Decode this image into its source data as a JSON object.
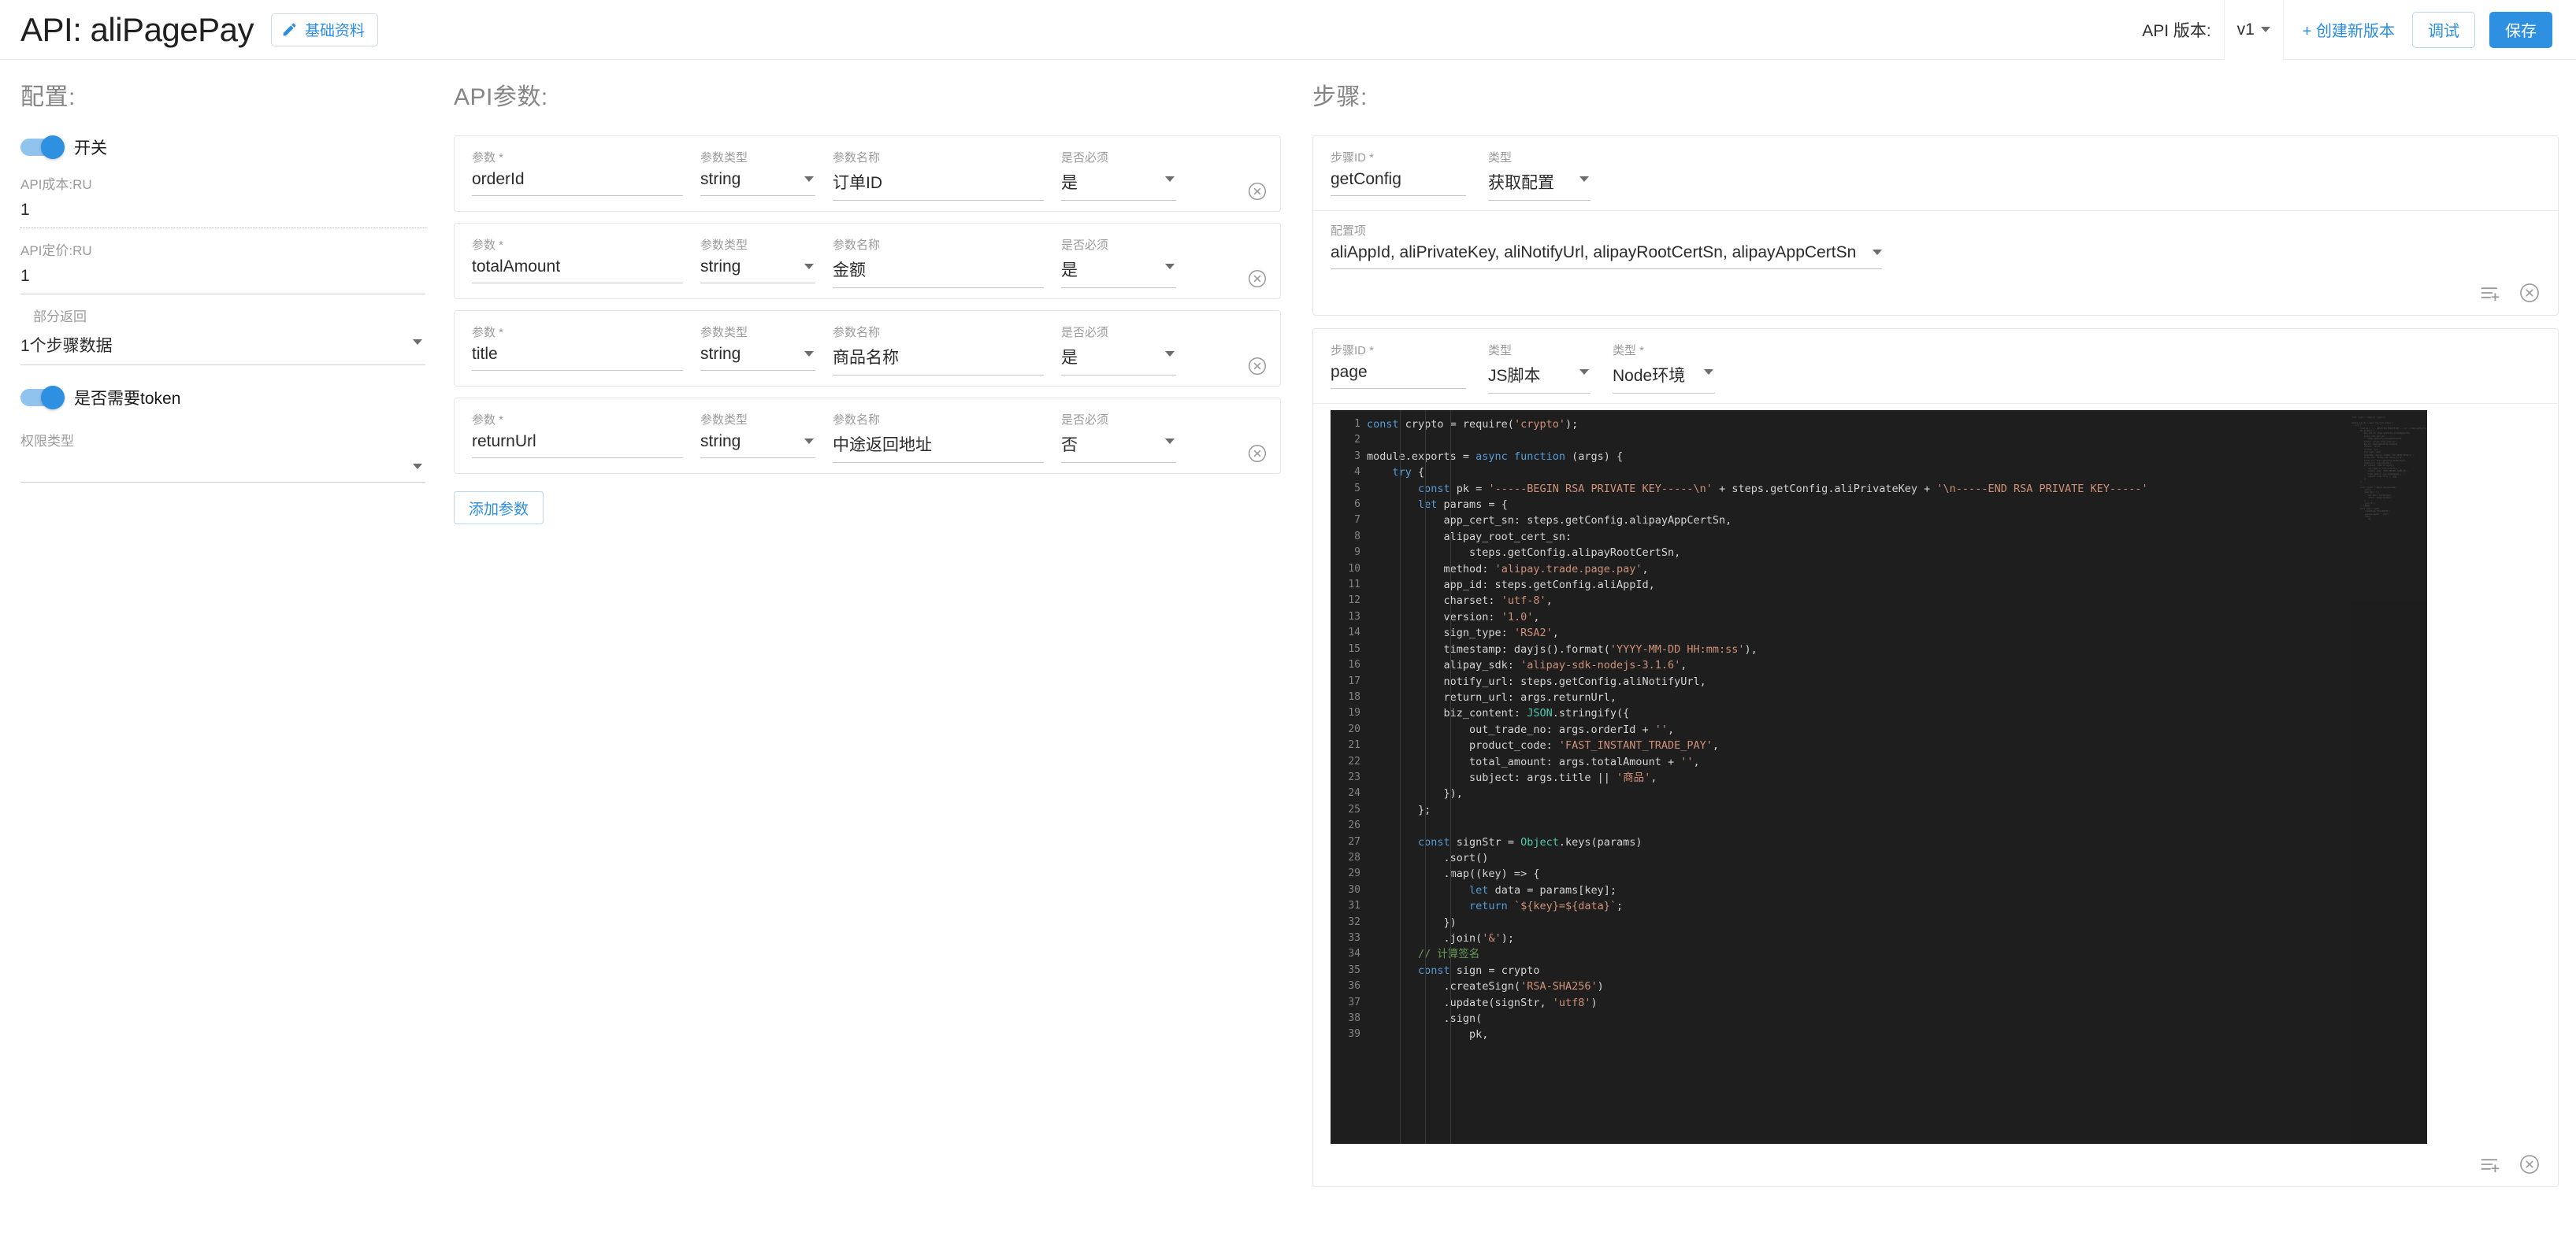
{
  "header": {
    "title": "API: aliPagePay",
    "basic_info_label": "基础资料",
    "api_version_label": "API 版本:",
    "version_value": "v1",
    "create_version_label": "+ 创建新版本",
    "debug_label": "调试",
    "save_label": "保存"
  },
  "config": {
    "section_title": "配置:",
    "switch_label": "开关",
    "cost_label": "API成本:RU",
    "cost_value": "1",
    "price_label": "API定价:RU",
    "price_value": "1",
    "partial_return_label": "部分返回",
    "partial_return_value": "1个步骤数据",
    "token_label": "是否需要token",
    "permission_label": "权限类型",
    "permission_value": ""
  },
  "params": {
    "section_title": "API参数:",
    "labels": {
      "name": "参数",
      "type": "参数类型",
      "display_name": "参数名称",
      "required": "是否必须"
    },
    "add_button": "添加参数",
    "rows": [
      {
        "name": "orderId",
        "type": "string",
        "display_name": "订单ID",
        "required": "是"
      },
      {
        "name": "totalAmount",
        "type": "string",
        "display_name": "金额",
        "required": "是"
      },
      {
        "name": "title",
        "type": "string",
        "display_name": "商品名称",
        "required": "是"
      },
      {
        "name": "returnUrl",
        "type": "string",
        "display_name": "中途返回地址",
        "required": "否"
      }
    ]
  },
  "steps": {
    "section_title": "步骤:",
    "labels": {
      "step_id": "步骤ID",
      "type": "类型",
      "env": "类型",
      "config_items": "配置项"
    },
    "step1": {
      "step_id": "getConfig",
      "type": "获取配置",
      "config_items_value": "aliAppId, aliPrivateKey, aliNotifyUrl, alipayRootCertSn, alipayAppCertSn"
    },
    "step2": {
      "step_id": "page",
      "type": "JS脚本",
      "env": "Node环境"
    }
  },
  "code": {
    "language": "javascript",
    "first_line": 1,
    "last_visible_line": 39,
    "lines": [
      "const crypto = require('crypto');",
      "",
      "module.exports = async function (args) {",
      "    try {",
      "        const pk = '-----BEGIN RSA PRIVATE KEY-----\\n' + steps.getConfig.aliPrivateKey + '\\n-----END RSA PRIVATE KEY-----'",
      "        let params = {",
      "            app_cert_sn: steps.getConfig.alipayAppCertSn,",
      "            alipay_root_cert_sn:",
      "                steps.getConfig.alipayRootCertSn,",
      "            method: 'alipay.trade.page.pay',",
      "            app_id: steps.getConfig.aliAppId,",
      "            charset: 'utf-8',",
      "            version: '1.0',",
      "            sign_type: 'RSA2',",
      "            timestamp: dayjs().format('YYYY-MM-DD HH:mm:ss'),",
      "            alipay_sdk: 'alipay-sdk-nodejs-3.1.6',",
      "            notify_url: steps.getConfig.aliNotifyUrl,",
      "            return_url: args.returnUrl,",
      "            biz_content: JSON.stringify({",
      "                out_trade_no: args.orderId + '',",
      "                product_code: 'FAST_INSTANT_TRADE_PAY',",
      "                total_amount: args.totalAmount + '',",
      "                subject: args.title || '商品',",
      "            }),",
      "        };",
      "",
      "        const signStr = Object.keys(params)",
      "            .sort()",
      "            .map((key) => {",
      "                let data = params[key];",
      "                return `${key}=${data}`;",
      "            })",
      "            .join('&');",
      "        // 计算签名",
      "        const sign = crypto",
      "            .createSign('RSA-SHA256')",
      "            .update(signStr, 'utf8')",
      "            .sign(",
      "                pk,"
    ]
  },
  "icons": {
    "add_list": "add-list-icon",
    "close_circle": "close-circle-icon",
    "pencil": "pencil-icon",
    "caret_down": "chevron-down-icon"
  },
  "colors": {
    "accent": "#2e90e0",
    "link": "#2c8ee0",
    "editor_bg": "#1e1e1e",
    "muted_text": "#9b9b9b"
  }
}
